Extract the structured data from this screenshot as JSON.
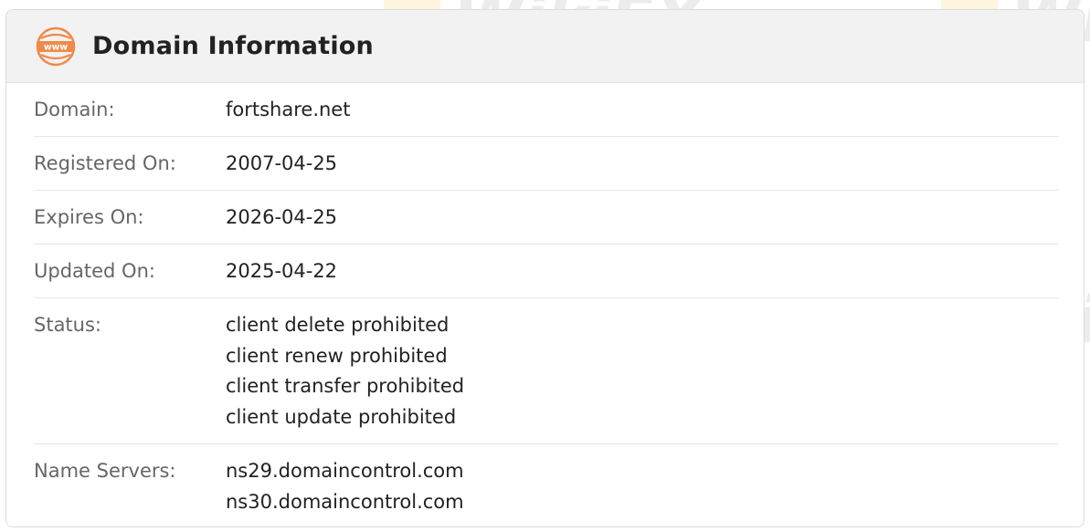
{
  "card": {
    "title": "Domain Information",
    "icon": "www-globe-icon",
    "accent_color": "#f08a4b"
  },
  "rows": [
    {
      "label": "Domain:",
      "values": [
        "fortshare.net"
      ]
    },
    {
      "label": "Registered On:",
      "values": [
        "2007-04-25"
      ]
    },
    {
      "label": "Expires On:",
      "values": [
        "2026-04-25"
      ]
    },
    {
      "label": "Updated On:",
      "values": [
        "2025-04-22"
      ]
    },
    {
      "label": "Status:",
      "values": [
        "client delete prohibited",
        "client renew prohibited",
        "client transfer prohibited",
        "client update prohibited"
      ]
    },
    {
      "label": "Name Servers:",
      "values": [
        "ns29.domaincontrol.com",
        "ns30.domaincontrol.com"
      ]
    }
  ],
  "watermark": {
    "text": "WikiFX",
    "badge_color": "#f0b400"
  }
}
